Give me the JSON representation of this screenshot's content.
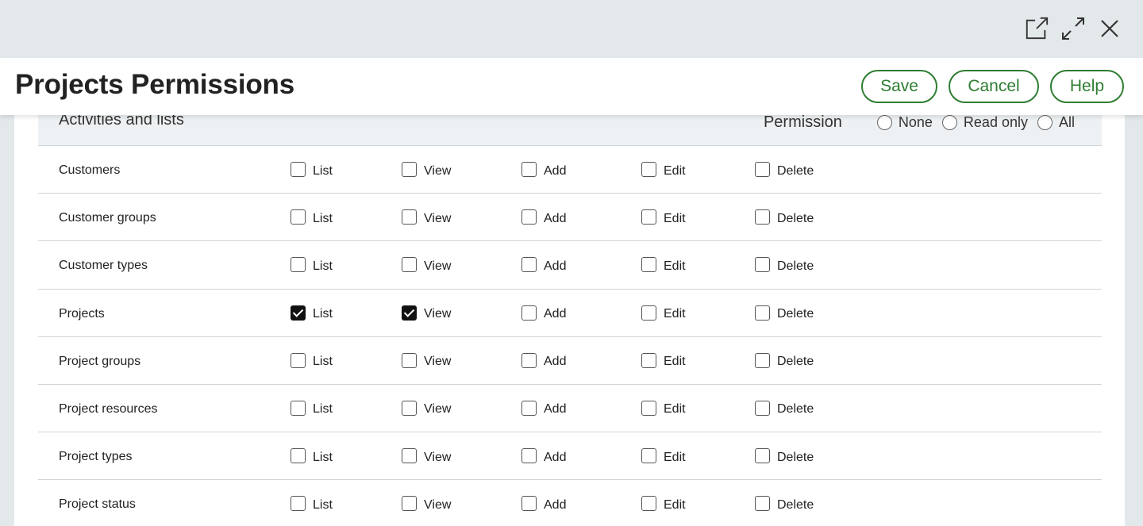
{
  "window": {
    "icons": [
      "open-external-icon",
      "expand-icon",
      "close-icon"
    ]
  },
  "header": {
    "title": "Projects Permissions",
    "save_label": "Save",
    "cancel_label": "Cancel",
    "help_label": "Help"
  },
  "table": {
    "column_label": "Activities and lists",
    "permission_label": "Permission",
    "options": [
      "None",
      "Read only",
      "All"
    ],
    "checkbox_labels": [
      "List",
      "View",
      "Add",
      "Edit",
      "Delete"
    ],
    "rows": [
      {
        "label": "Customers",
        "checked": [
          false,
          false,
          false,
          false,
          false
        ]
      },
      {
        "label": "Customer groups",
        "checked": [
          false,
          false,
          false,
          false,
          false
        ]
      },
      {
        "label": "Customer types",
        "checked": [
          false,
          false,
          false,
          false,
          false
        ]
      },
      {
        "label": "Projects",
        "checked": [
          true,
          true,
          false,
          false,
          false
        ]
      },
      {
        "label": "Project groups",
        "checked": [
          false,
          false,
          false,
          false,
          false
        ]
      },
      {
        "label": "Project resources",
        "checked": [
          false,
          false,
          false,
          false,
          false
        ]
      },
      {
        "label": "Project types",
        "checked": [
          false,
          false,
          false,
          false,
          false
        ]
      },
      {
        "label": "Project status",
        "checked": [
          false,
          false,
          false,
          false,
          false
        ]
      }
    ]
  },
  "colors": {
    "accent": "#2e7d32",
    "modal_bar": "#e3e8eb",
    "table_head": "#eef1f3"
  }
}
